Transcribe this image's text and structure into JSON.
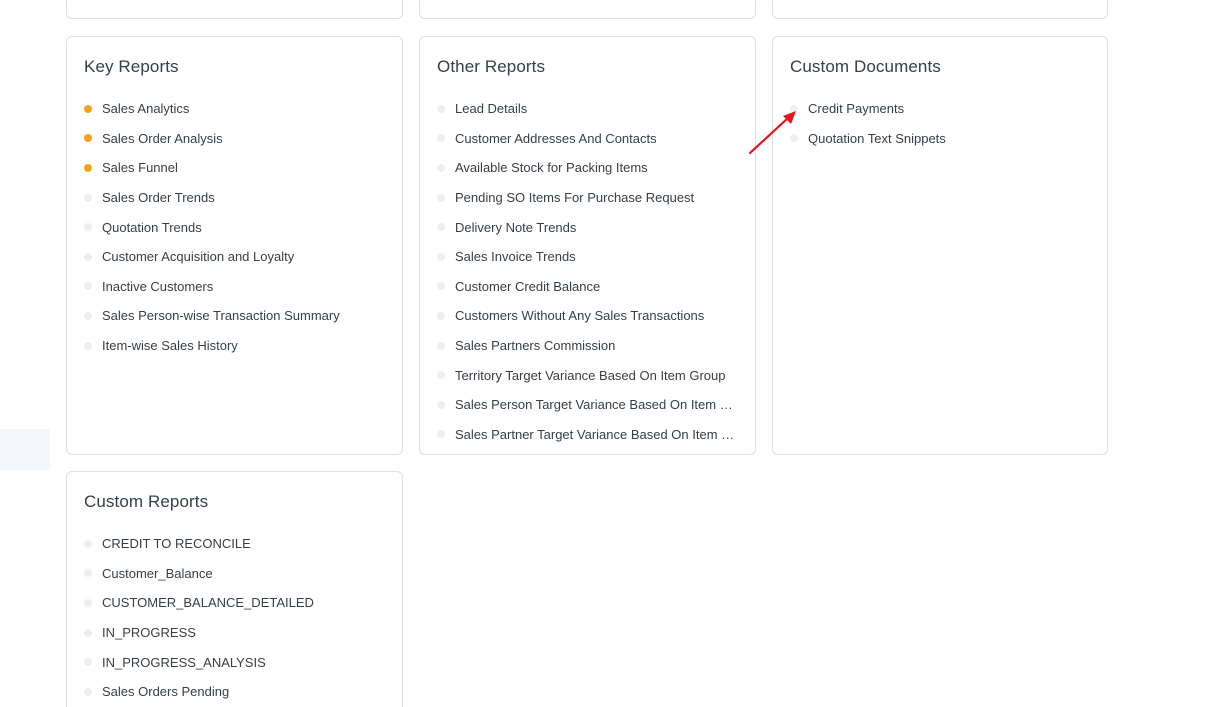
{
  "cards": {
    "key_reports": {
      "title": "Key Reports",
      "items": [
        {
          "label": "Sales Analytics",
          "highlight": true
        },
        {
          "label": "Sales Order Analysis",
          "highlight": true
        },
        {
          "label": "Sales Funnel",
          "highlight": true
        },
        {
          "label": "Sales Order Trends",
          "highlight": false
        },
        {
          "label": "Quotation Trends",
          "highlight": false
        },
        {
          "label": "Customer Acquisition and Loyalty",
          "highlight": false
        },
        {
          "label": "Inactive Customers",
          "highlight": false
        },
        {
          "label": "Sales Person-wise Transaction Summary",
          "highlight": false
        },
        {
          "label": "Item-wise Sales History",
          "highlight": false
        }
      ]
    },
    "other_reports": {
      "title": "Other Reports",
      "items": [
        {
          "label": "Lead Details",
          "highlight": false
        },
        {
          "label": "Customer Addresses And Contacts",
          "highlight": false
        },
        {
          "label": "Available Stock for Packing Items",
          "highlight": false
        },
        {
          "label": "Pending SO Items For Purchase Request",
          "highlight": false
        },
        {
          "label": "Delivery Note Trends",
          "highlight": false
        },
        {
          "label": "Sales Invoice Trends",
          "highlight": false
        },
        {
          "label": "Customer Credit Balance",
          "highlight": false
        },
        {
          "label": "Customers Without Any Sales Transactions",
          "highlight": false
        },
        {
          "label": "Sales Partners Commission",
          "highlight": false
        },
        {
          "label": "Territory Target Variance Based On Item Group",
          "highlight": false
        },
        {
          "label": "Sales Person Target Variance Based On Item Group",
          "highlight": false
        },
        {
          "label": "Sales Partner Target Variance Based On Item Group",
          "highlight": false
        }
      ]
    },
    "custom_documents": {
      "title": "Custom Documents",
      "items": [
        {
          "label": "Credit Payments",
          "highlight": false
        },
        {
          "label": "Quotation Text Snippets",
          "highlight": false
        }
      ]
    },
    "custom_reports": {
      "title": "Custom Reports",
      "items": [
        {
          "label": "CREDIT TO RECONCILE",
          "highlight": false
        },
        {
          "label": "Customer_Balance",
          "highlight": false
        },
        {
          "label": "CUSTOMER_BALANCE_DETAILED",
          "highlight": false
        },
        {
          "label": "IN_PROGRESS",
          "highlight": false
        },
        {
          "label": "IN_PROGRESS_ANALYSIS",
          "highlight": false
        },
        {
          "label": "Sales Orders Pending",
          "highlight": false
        }
      ]
    }
  },
  "colors": {
    "highlight_dot": "#f8a31a",
    "normal_dot": "#eceff1",
    "annotation_arrow": "#e8141b"
  }
}
